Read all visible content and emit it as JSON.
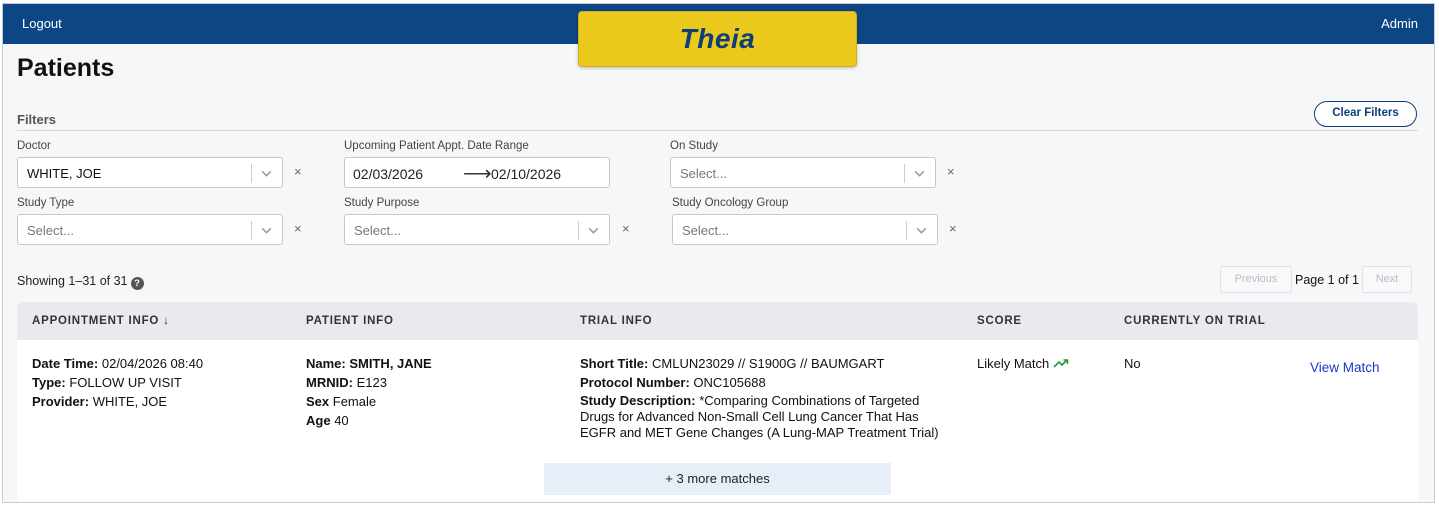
{
  "header": {
    "logout": "Logout",
    "admin": "Admin",
    "brand": "Theia"
  },
  "page": {
    "title": "Patients"
  },
  "filters": {
    "label": "Filters",
    "clear": "Clear Filters",
    "doctor": {
      "label": "Doctor",
      "value": "WHITE, JOE"
    },
    "date_range": {
      "label": "Upcoming Patient Appt. Date Range",
      "start": "02/03/2026",
      "end": "02/10/2026",
      "arrow": "⟶"
    },
    "on_study": {
      "label": "On Study",
      "placeholder": "Select..."
    },
    "study_type": {
      "label": "Study Type",
      "placeholder": "Select..."
    },
    "study_purpose": {
      "label": "Study Purpose",
      "placeholder": "Select..."
    },
    "study_oncology_group": {
      "label": "Study Oncology Group",
      "placeholder": "Select..."
    },
    "clear_x": "×"
  },
  "results": {
    "showing": "Showing 1–31 of 31",
    "help": "?"
  },
  "pagination": {
    "previous": "Previous",
    "page": "Page 1 of 1",
    "next": "Next"
  },
  "table": {
    "headers": {
      "appointment": "APPOINTMENT INFO",
      "sort_arrow": "↓",
      "patient": "PATIENT INFO",
      "trial": "TRIAL INFO",
      "score": "SCORE",
      "on_trial": "CURRENTLY ON TRIAL"
    },
    "row": {
      "date_time_label": "Date Time:",
      "date_time": "02/04/2026 08:40",
      "type_label": "Type:",
      "type": "FOLLOW UP VISIT",
      "provider_label": "Provider:",
      "provider": "WHITE, JOE",
      "name_label": "Name:",
      "name": "SMITH, JANE",
      "mrnid_label": "MRNID:",
      "mrnid": "E123",
      "sex_label": "Sex",
      "sex": "Female",
      "age_label": "Age",
      "age": "40",
      "short_title_label": "Short Title:",
      "short_title": "CMLUN23029 // S1900G // BAUMGART",
      "protocol_label": "Protocol Number:",
      "protocol": "ONC105688",
      "description_label": "Study Description:",
      "description_line1": "*Comparing Combinations of Targeted",
      "description_line2": "Drugs for Advanced Non-Small Cell Lung Cancer That Has",
      "description_line3": "EGFR and MET Gene Changes (A Lung-MAP Treatment Trial)",
      "score": "Likely Match",
      "score_icon": "trending-up-icon",
      "score_color": "#1e9a3c",
      "on_trial": "No",
      "view_match": "View Match",
      "more_matches": "+ 3 more matches"
    }
  },
  "colors": {
    "header_bg": "#0c4684",
    "brand_bg": "#ebc81c",
    "brand_text": "#0c3f7a",
    "link": "#1b39c9"
  }
}
